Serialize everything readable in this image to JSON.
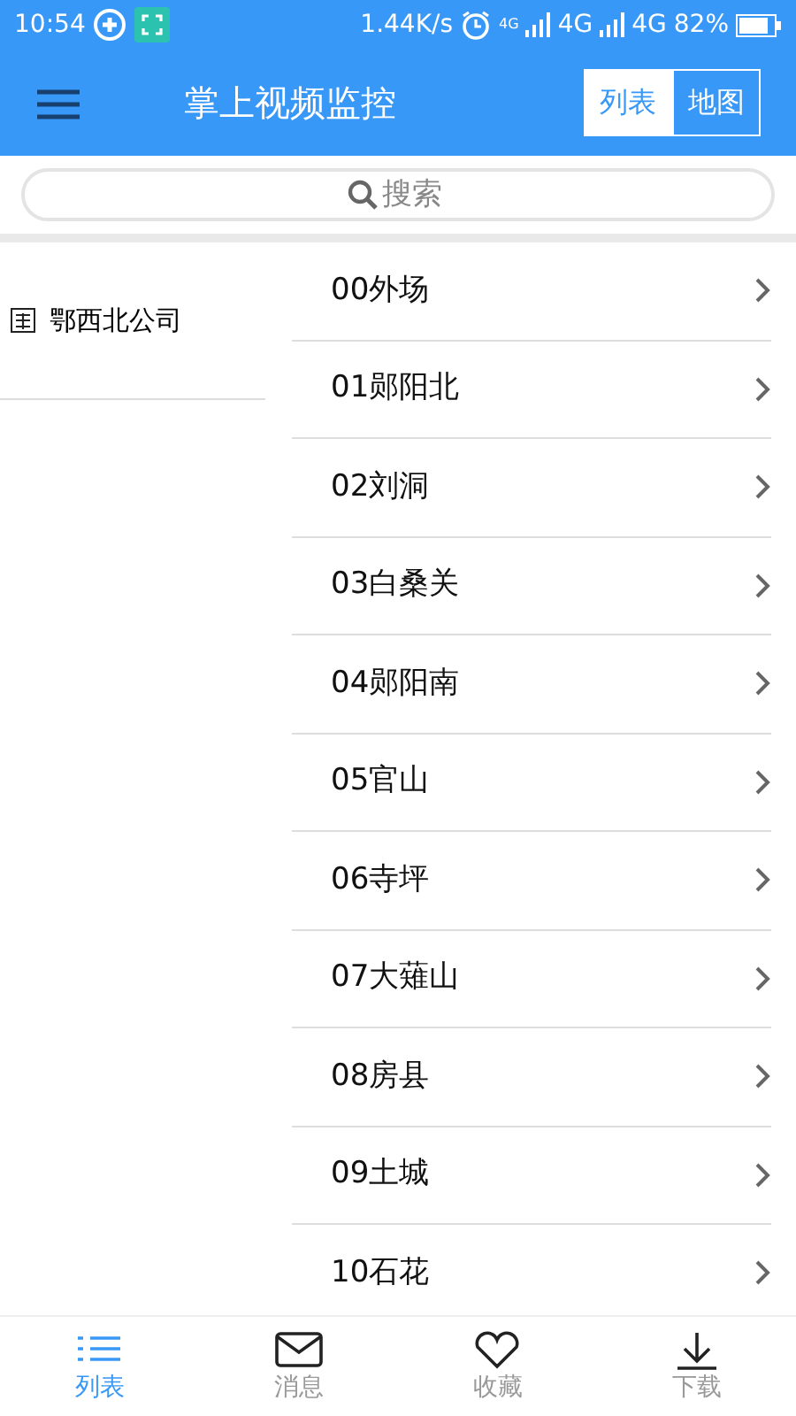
{
  "status_bar": {
    "time": "10:54",
    "speed": "1.44K/s",
    "net_small": "4G",
    "sim1": "4G",
    "sim2": "4G",
    "battery": "82%"
  },
  "header": {
    "title": "掌上视频监控",
    "toggle": [
      {
        "label": "列表",
        "selected": true
      },
      {
        "label": "地图",
        "selected": false
      }
    ]
  },
  "search": {
    "placeholder": "搜索"
  },
  "sidebar": {
    "items": [
      {
        "label": "鄂西北公司",
        "selected": true
      }
    ]
  },
  "stations": [
    {
      "label": "00外场"
    },
    {
      "label": "01郧阳北"
    },
    {
      "label": "02刘洞"
    },
    {
      "label": "03白桑关"
    },
    {
      "label": "04郧阳南"
    },
    {
      "label": "05官山"
    },
    {
      "label": "06寺坪"
    },
    {
      "label": "07大薙山"
    },
    {
      "label": "08房县"
    },
    {
      "label": "09土城"
    },
    {
      "label": "10石花"
    }
  ],
  "bottom_nav": [
    {
      "label": "列表",
      "kind": "list",
      "selected": true
    },
    {
      "label": "消息",
      "kind": "mail",
      "selected": false
    },
    {
      "label": "收藏",
      "kind": "heart",
      "selected": false
    },
    {
      "label": "下载",
      "kind": "download",
      "selected": false
    }
  ]
}
